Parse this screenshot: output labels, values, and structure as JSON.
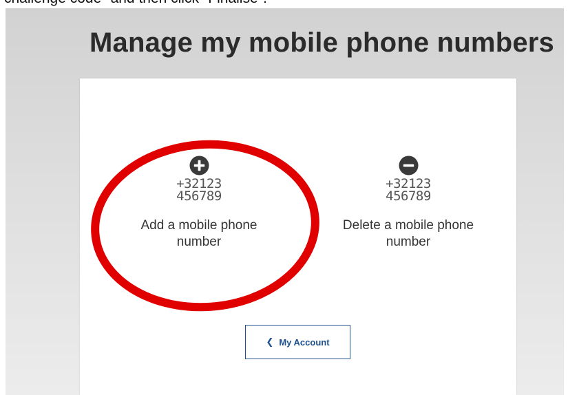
{
  "caption": "challenge code\" and then click \"Finalise\".",
  "page": {
    "title": "Manage my mobile phone numbers"
  },
  "options": {
    "add": {
      "icon": "plus-circle-icon",
      "phone_line1": "+32123",
      "phone_line2": "456789",
      "label_line1": "Add a mobile phone",
      "label_line2": "number"
    },
    "delete": {
      "icon": "minus-circle-icon",
      "phone_line1": "+32123",
      "phone_line2": "456789",
      "label_line1": "Delete a mobile phone",
      "label_line2": "number"
    }
  },
  "back_button": {
    "icon": "chevron-left-icon",
    "label": "My Account"
  },
  "colors": {
    "title": "#2b2b2b",
    "icon": "#3a3a3a",
    "button_border": "#1d4f8c",
    "button_text": "#1d4f8c",
    "annotation": "#e00000"
  }
}
